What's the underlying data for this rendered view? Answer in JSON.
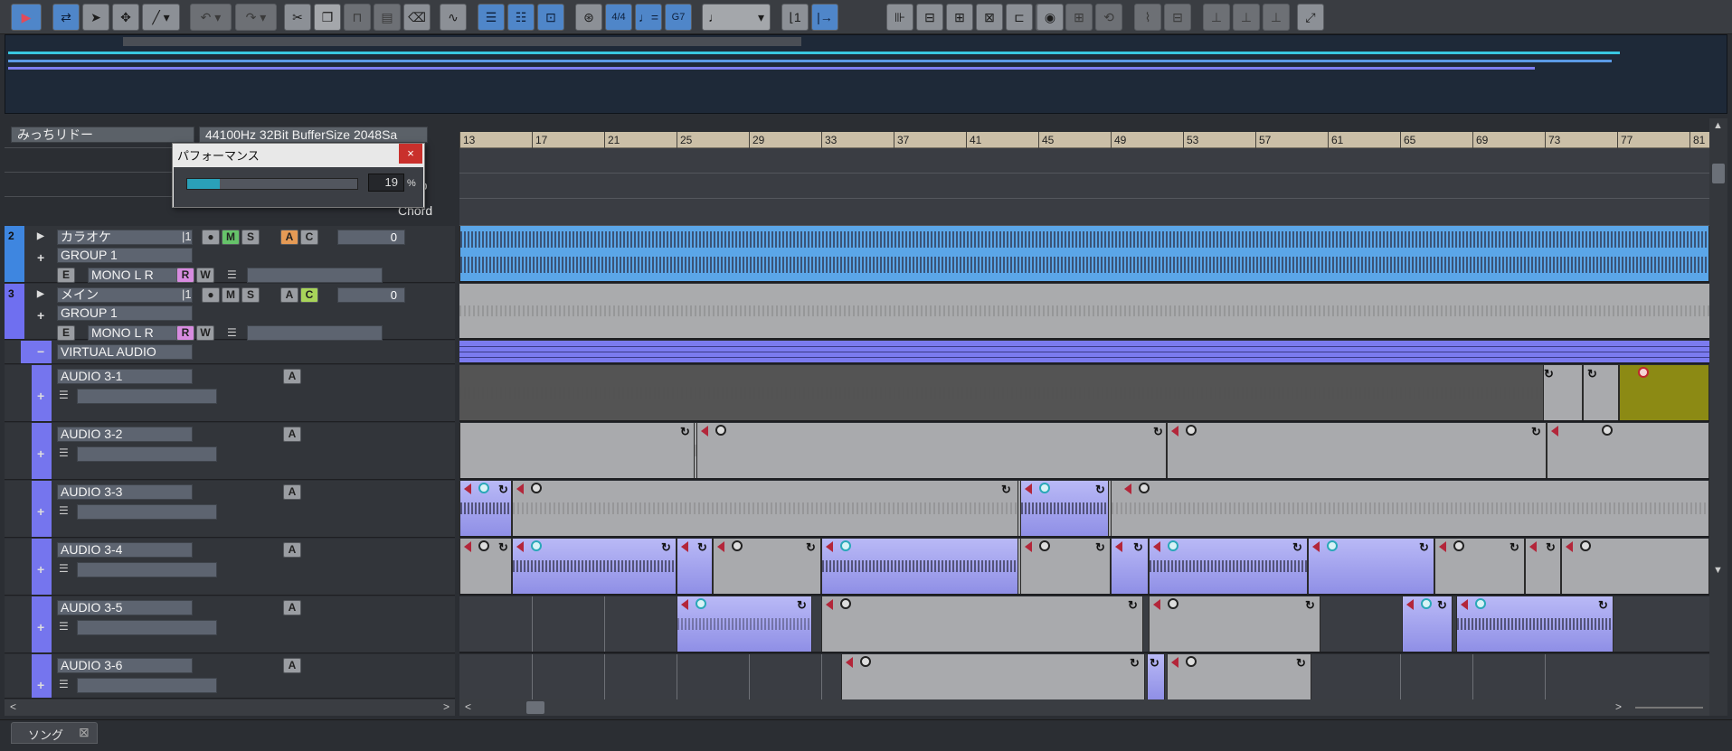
{
  "toolbar": {
    "buttons": [
      "play",
      "object-tool",
      "select-tool",
      "arrow-tool",
      "pencil-tool",
      "undo",
      "redo",
      "cut",
      "copy",
      "paste",
      "delete",
      "erase",
      "audio-tool",
      "track-view",
      "mixer-view",
      "score-view",
      "snap-tool",
      "meter",
      "tempo",
      "chord",
      "note-length",
      "quantize-1",
      "quantize-2",
      "align",
      "split-1",
      "split-2",
      "split-3",
      "export",
      "bounce",
      "loop",
      "mark-1",
      "mark-2",
      "mark-3",
      "mark-4",
      "mark-5",
      "mark-6",
      "mark-7",
      "expand"
    ],
    "meter_label": "4/4",
    "chord_label": "G7",
    "note_length": "♩"
  },
  "header": {
    "song_name": "みっちリドー",
    "audio_info": "44100Hz 32Bit BufferSize 2048Sa",
    "lanes": [
      "Beat",
      "Tempo",
      "Chord"
    ],
    "visible_lane_fragments": [
      "at",
      "po",
      "Chord"
    ]
  },
  "ruler": {
    "ticks": [
      "13",
      "17",
      "21",
      "25",
      "29",
      "33",
      "37",
      "41",
      "45",
      "49",
      "53",
      "57",
      "61",
      "65",
      "69",
      "73",
      "77",
      "81"
    ]
  },
  "performance": {
    "title": "パフォーマンス",
    "close": "×",
    "value": "19",
    "unit": "%",
    "level": 0.19
  },
  "tracks": {
    "t2": {
      "num": "2",
      "name": "カラオケ",
      "channel": "|1",
      "group": "GROUP 1",
      "io": "MONO L R",
      "volume": "0",
      "e": "E",
      "r": "R",
      "w": "W",
      "m": "M",
      "s": "S",
      "a": "A",
      "c": "C",
      "color": "#3e86e0"
    },
    "t3": {
      "num": "3",
      "name": "メイン",
      "channel": "|1",
      "group": "GROUP 1",
      "io": "MONO L R",
      "volume": "0",
      "e": "E",
      "r": "R",
      "w": "W",
      "m": "M",
      "s": "S",
      "a": "A",
      "c": "C",
      "color": "#6f6ff0"
    },
    "virtual": {
      "name": "VIRTUAL AUDIO",
      "minus": "−"
    },
    "audio": [
      {
        "name": "AUDIO 3-1",
        "a": "A"
      },
      {
        "name": "AUDIO 3-2",
        "a": "A"
      },
      {
        "name": "AUDIO 3-3",
        "a": "A"
      },
      {
        "name": "AUDIO 3-4",
        "a": "A"
      },
      {
        "name": "AUDIO 3-5",
        "a": "A"
      },
      {
        "name": "AUDIO 3-6",
        "a": "A"
      }
    ]
  },
  "bottom": {
    "tab_label": "ソング",
    "tab_close": "⊠"
  }
}
